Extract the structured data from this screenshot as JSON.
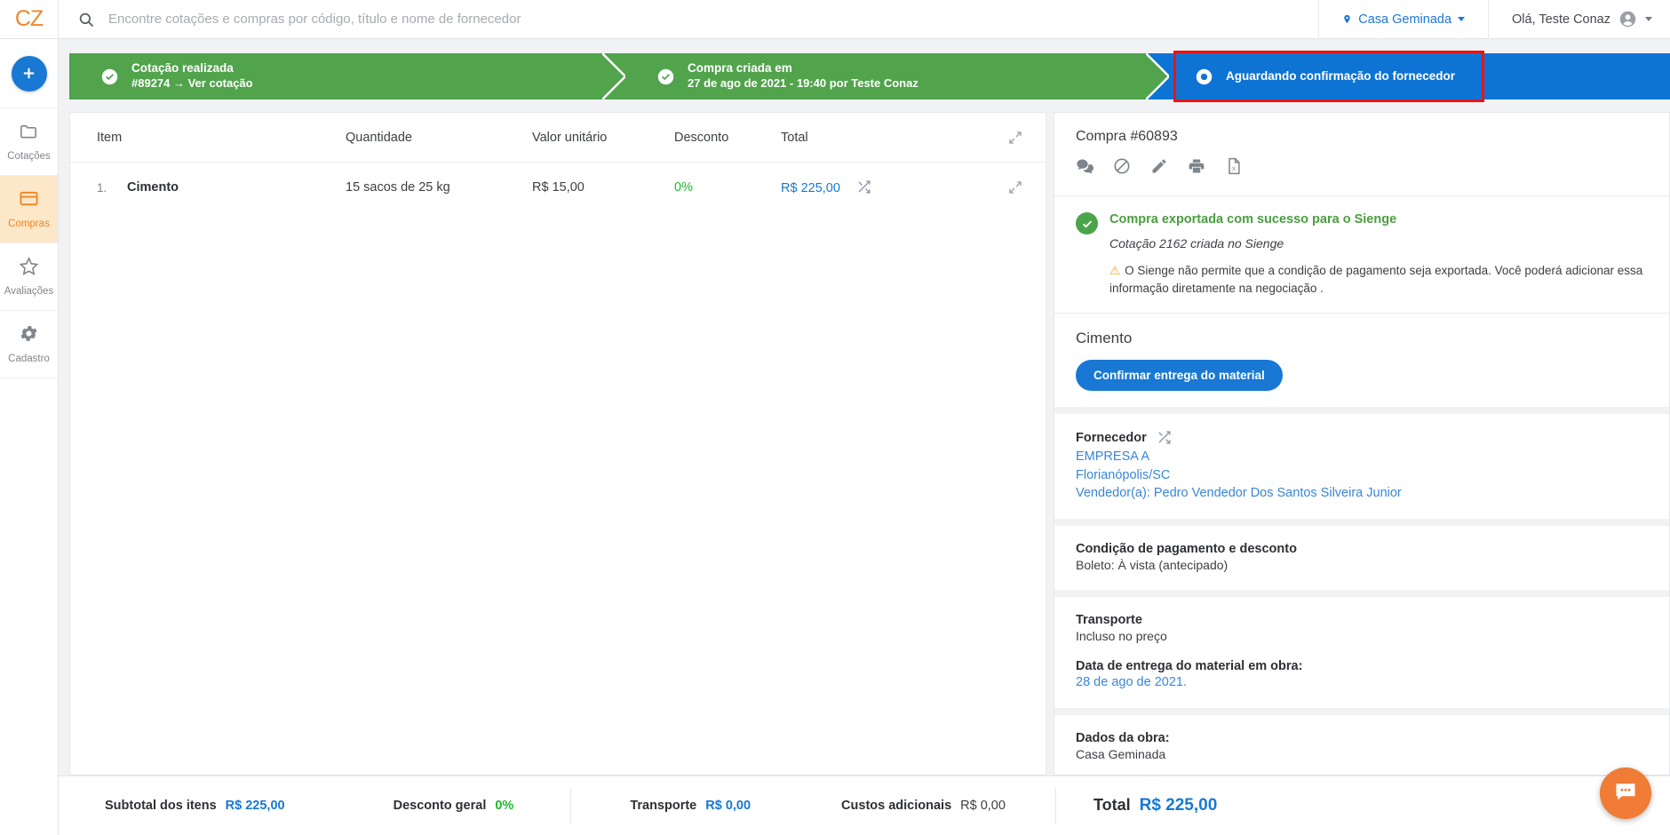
{
  "topbar": {
    "logo": "CZ",
    "search_placeholder": "Encontre cotações e compras por código, título e nome de fornecedor",
    "search_value": "",
    "obra_label": "Casa Geminada",
    "user_label": "Olá, Teste Conaz"
  },
  "sidebar": {
    "add_label": "+",
    "items": [
      {
        "label": "Cotações",
        "icon": "folder-icon",
        "active": false
      },
      {
        "label": "Compras",
        "icon": "credit-card-icon",
        "active": true
      },
      {
        "label": "Avaliações",
        "icon": "star-icon",
        "active": false
      },
      {
        "label": "Cadastro",
        "icon": "gear-icon",
        "active": false
      }
    ]
  },
  "stepper": {
    "steps": [
      {
        "line1": "Cotação realizada",
        "line2": "#89274 → Ver cotação",
        "state": "done"
      },
      {
        "line1": "Compra criada em",
        "line2": "27 de ago de 2021 - 19:40 por Teste Conaz",
        "state": "done"
      },
      {
        "line1": "Aguardando confirmação do fornecedor",
        "line2": "",
        "state": "current"
      }
    ]
  },
  "table": {
    "headers": [
      "Item",
      "Quantidade",
      "Valor unitário",
      "Desconto",
      "Total"
    ],
    "rows": [
      {
        "index": "1.",
        "item": "Cimento",
        "quantidade": "15 sacos de 25 kg",
        "valor_unitario": "R$ 15,00",
        "desconto": "0%",
        "total": "R$ 225,00"
      }
    ]
  },
  "right_panel": {
    "purchase_title": "Compra #60893",
    "action_icons": [
      "chat-icon",
      "ban-icon",
      "pencil-icon",
      "printer-icon",
      "excel-export-icon"
    ],
    "export": {
      "title": "Compra exportada com sucesso para o Sienge",
      "subtitle": "Cotação 2162 criada no Sienge",
      "warning": "O Sienge não permite que a condição de pagamento seja exportada. Você poderá adicionar essa informação diretamente na negociação ."
    },
    "material_title": "Cimento",
    "confirm_button": "Confirmar entrega do material",
    "fornecedor": {
      "label": "Fornecedor",
      "company": "EMPRESA A",
      "city": "Florianópolis/SC",
      "seller": "Vendedor(a): Pedro Vendedor Dos Santos Silveira Junior"
    },
    "pagamento": {
      "label": "Condição de pagamento e desconto",
      "value": "Boleto: À vista (antecipado)"
    },
    "transporte": {
      "label": "Transporte",
      "value": "Incluso no preço",
      "delivery_label": "Data de entrega do material em obra:",
      "delivery_value": "28 de ago de 2021."
    },
    "obra": {
      "label": "Dados da obra:",
      "value": "Casa Geminada"
    }
  },
  "bottombar": {
    "subtotal_label": "Subtotal dos itens",
    "subtotal_value": "R$ 225,00",
    "desconto_label": "Desconto geral",
    "desconto_value": "0%",
    "transporte_label": "Transporte",
    "transporte_value": "R$ 0,00",
    "custos_label": "Custos adicionais",
    "custos_value": "R$ 0,00",
    "total_label": "Total",
    "total_value": "R$ 225,00"
  },
  "chat": {
    "icon": "chat-bubble-icon"
  },
  "colors": {
    "brand_orange": "#f0872b",
    "primary_blue": "#1878d4",
    "success_green": "#51a34c",
    "highlight_red": "#ef1111",
    "percent_green": "#21b82d"
  }
}
